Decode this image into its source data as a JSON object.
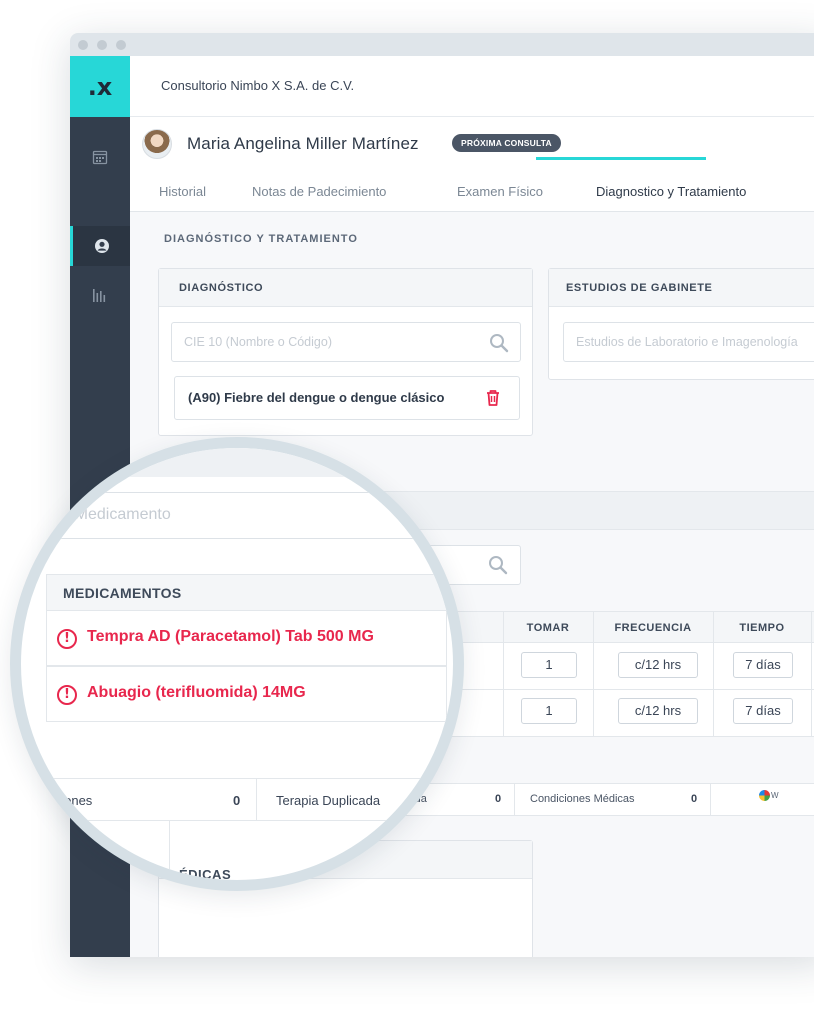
{
  "app": {
    "logo": ".x",
    "clinic_name": "Consultorio Nimbo X S.A. de C.V."
  },
  "sidebar": {
    "items": [
      {
        "icon": "calendar-icon"
      },
      {
        "icon": "user-icon",
        "active": true
      },
      {
        "icon": "chart-bars-icon"
      }
    ]
  },
  "patient": {
    "name": "Maria Angelina Miller Martínez",
    "badge": "PRÓXIMA CONSULTA"
  },
  "tabs": [
    {
      "label": "Historial"
    },
    {
      "label": "Notas de Padecimiento"
    },
    {
      "label": "Examen Físico"
    },
    {
      "label": "Diagnostico y Tratamiento",
      "active": true
    }
  ],
  "main": {
    "section_title": "DIAGNÓSTICO Y TRATAMIENTO",
    "diagnostico": {
      "title": "DIAGNÓSTICO",
      "search_placeholder": "CIE 10 (Nombre o Código)",
      "selected": "(A90) Fiebre del dengue o dengue clásico"
    },
    "gabinete": {
      "title": "ESTUDIOS DE GABINETE",
      "search_placeholder": "Estudios de Laboratorio e Imagenología"
    },
    "medicamentos": {
      "search_placeholder": "car Medicamento",
      "header": "MEDICAMENTOS",
      "columns": [
        "TOMAR",
        "FRECUENCIA",
        "TIEMPO"
      ],
      "rows": [
        {
          "name": "Tempra AD (Paracetamol) Tab 500 MG",
          "tomar": "1",
          "frecuencia": "c/12 hrs",
          "tiempo": "7 días"
        },
        {
          "name": "Abuagio (terifluomida) 14MG",
          "tomar": "1",
          "frecuencia": "c/12 hrs",
          "tiempo": "7 días"
        }
      ]
    },
    "interacciones": {
      "partial_label": "cada",
      "partial_count": "0",
      "condiciones_label": "Condiciones Médicas",
      "condiciones_count": "0",
      "acciones_label": "acciones",
      "acciones_count": "0",
      "terapia_label": "Terapia Duplicada",
      "brand_fragment": "W"
    },
    "notas": {
      "partial_title": "ÉDICAS"
    }
  },
  "colors": {
    "accent": "#27d7d7",
    "sidebar": "#333e4d",
    "alert": "#e8274d",
    "delete": "#e8274d"
  }
}
